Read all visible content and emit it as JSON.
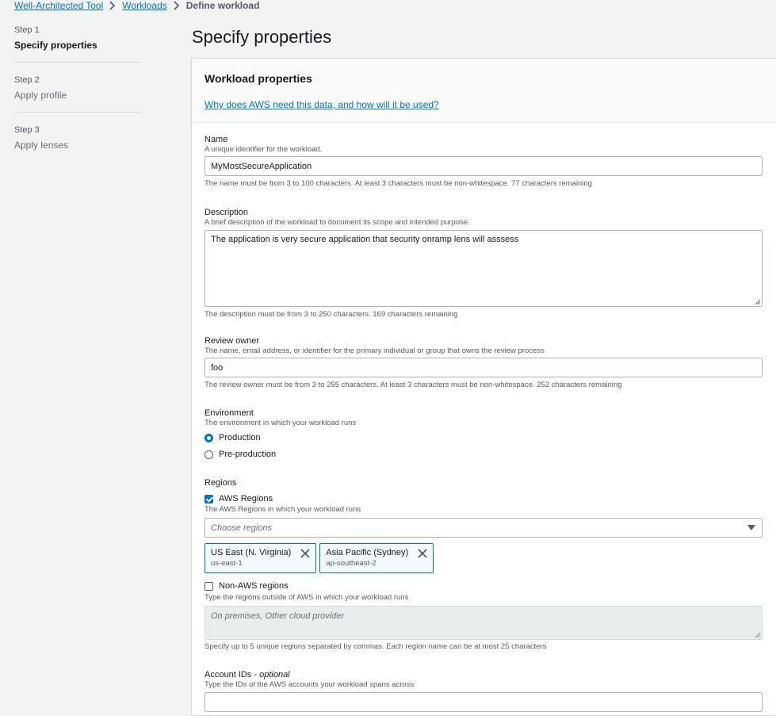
{
  "breadcrumb": {
    "items": [
      "Well-Architected Tool",
      "Workloads"
    ],
    "current": "Define workload"
  },
  "steps": [
    {
      "num": "Step 1",
      "name": "Specify properties"
    },
    {
      "num": "Step 2",
      "name": "Apply profile"
    },
    {
      "num": "Step 3",
      "name": "Apply lenses"
    }
  ],
  "page_title": "Specify properties",
  "panel": {
    "title": "Workload properties",
    "info_link": "Why does AWS need this data, and how will it be used?"
  },
  "name": {
    "label": "Name",
    "description": "A unique identifier for the workload.",
    "value": "MyMostSecureApplication",
    "hint": "The name must be from 3 to 100 characters. At least 3 characters must be non-whitespace. 77 characters remaining"
  },
  "description": {
    "label": "Description",
    "description": "A brief description of the workload to document its scope and intended purpose.",
    "value": "The application is very secure application that security onramp lens will asssess",
    "hint": "The description must be from 3 to 250 characters. 169 characters remaining"
  },
  "review_owner": {
    "label": "Review owner",
    "description": "The name, email address, or identifier for the primary individual or group that owns the review process",
    "value": "foo",
    "hint": "The review owner must be from 3 to 255 characters. At least 3 characters must be non-whitespace. 252 characters remaining"
  },
  "environment": {
    "label": "Environment",
    "description": "The environment in which your workload runs",
    "options": [
      "Production",
      "Pre-production"
    ],
    "selected": "Production"
  },
  "regions": {
    "label": "Regions",
    "aws_checkbox": "AWS Regions",
    "aws_checked": true,
    "aws_description": "The AWS Regions in which your workload runs",
    "select_placeholder": "Choose regions",
    "tokens": [
      {
        "name": "US East (N. Virginia)",
        "code": "us-east-1"
      },
      {
        "name": "Asia Pacific (Sydney)",
        "code": "ap-southeast-2"
      }
    ],
    "non_aws_checkbox": "Non-AWS regions",
    "non_aws_checked": false,
    "non_aws_description": "Type the regions outside of AWS in which your workload runs",
    "non_aws_placeholder": "On premises, Other cloud provider",
    "non_aws_hint": "Specify up to 5 unique regions separated by commas. Each region name can be at most 25 characters"
  },
  "account_ids": {
    "label": "Account IDs",
    "label_suffix": "optional",
    "description": "Type the IDs of the AWS accounts your workload spans across"
  },
  "colors": {
    "link": "#0073bb",
    "background": "#f2f3f3",
    "panel": "#ffffff",
    "token_bg": "#f1faff"
  }
}
